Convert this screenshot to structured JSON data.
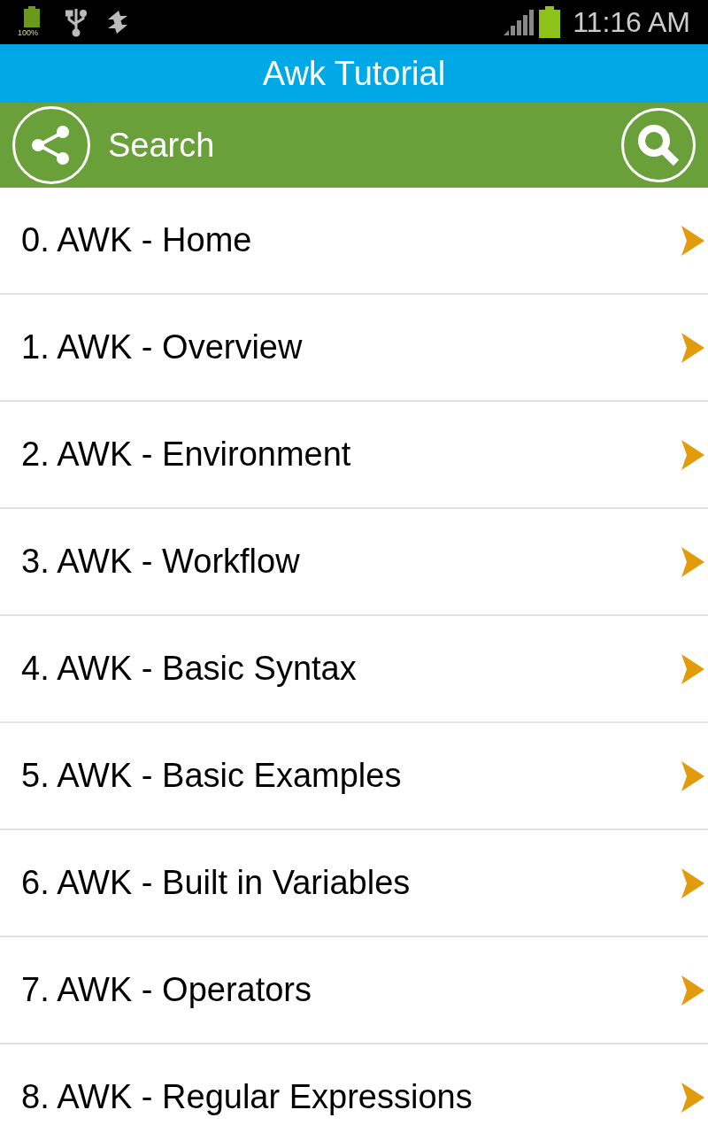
{
  "status_bar": {
    "battery_label": "100%",
    "time": "11:16 AM"
  },
  "title_bar": {
    "title": "Awk Tutorial"
  },
  "search_bar": {
    "placeholder": "Search"
  },
  "items": [
    {
      "label": "0. AWK - Home"
    },
    {
      "label": "1. AWK - Overview"
    },
    {
      "label": "2. AWK - Environment"
    },
    {
      "label": "3. AWK - Workflow"
    },
    {
      "label": "4. AWK - Basic Syntax"
    },
    {
      "label": "5. AWK - Basic Examples"
    },
    {
      "label": "6. AWK - Built in Variables"
    },
    {
      "label": "7. AWK - Operators"
    },
    {
      "label": "8. AWK - Regular Expressions"
    }
  ]
}
